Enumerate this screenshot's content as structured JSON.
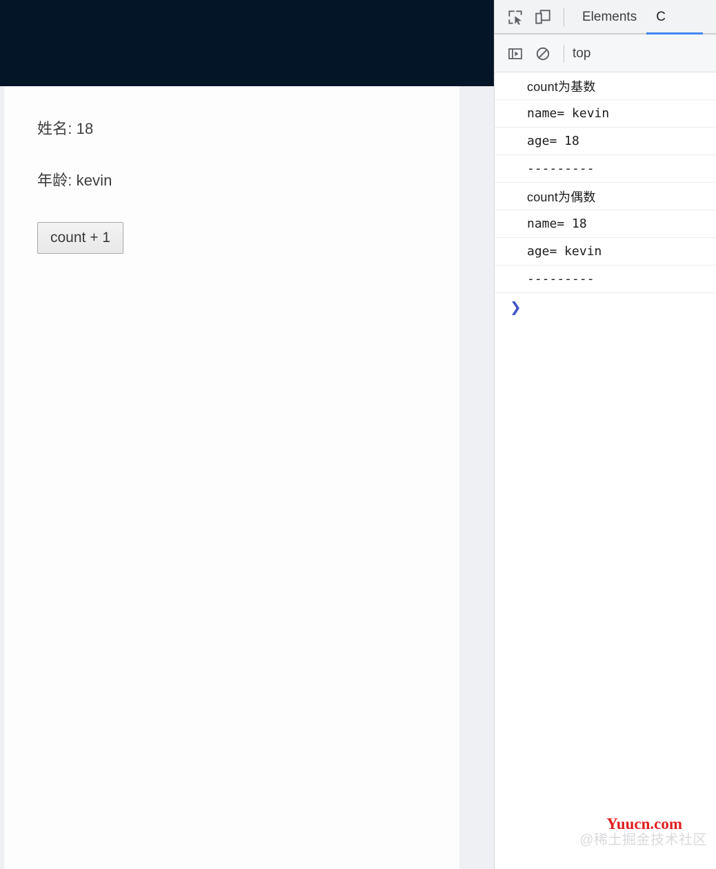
{
  "page": {
    "fields": [
      {
        "label": "姓名: 18"
      },
      {
        "label": "年龄: kevin"
      }
    ],
    "button_label": "count + 1"
  },
  "devtools": {
    "tabbar": {
      "inspect_icon": "inspect-element-icon",
      "device_icon": "device-toolbar-icon",
      "tabs": [
        {
          "label": "Elements",
          "active": false
        },
        {
          "label": "C",
          "active": true
        }
      ]
    },
    "filterbar": {
      "sidebar_icon": "console-sidebar-icon",
      "clear_icon": "clear-console-icon",
      "context": "top"
    },
    "console_messages": [
      {
        "text": "count为基数",
        "cjk": true
      },
      {
        "text": "name= kevin",
        "cjk": false
      },
      {
        "text": "age= 18",
        "cjk": false
      },
      {
        "text": "---------",
        "cjk": false
      },
      {
        "text": "count为偶数",
        "cjk": true
      },
      {
        "text": "name= 18",
        "cjk": false
      },
      {
        "text": "age= kevin",
        "cjk": false
      },
      {
        "text": "---------",
        "cjk": false
      }
    ],
    "prompt_glyph": "❯"
  },
  "watermark": {
    "chinese": "@稀土掘金技术社区",
    "english": "Yuucn.com"
  },
  "colors": {
    "page_header_navy": "#041527",
    "devtools_toolbar": "#f1f3f4",
    "accent_blue": "#4285f4",
    "prompt_blue": "#4055c4",
    "watermark_red": "#e02020"
  }
}
